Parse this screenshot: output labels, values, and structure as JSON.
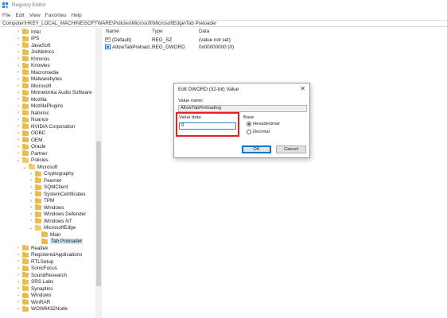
{
  "window": {
    "title": "Registry Editor"
  },
  "menu": [
    "File",
    "Edit",
    "View",
    "Favorites",
    "Help"
  ],
  "address": "Computer\\HKEY_LOCAL_MACHINE\\SOFTWARE\\Policies\\Microsoft\\MicrosoftEdge\\Tab Preloader",
  "tree": [
    {
      "label": "Intel",
      "expanded": false
    },
    {
      "label": "IPS",
      "expanded": false
    },
    {
      "label": "JavaSoft",
      "expanded": false
    },
    {
      "label": "JreMetrics",
      "expanded": false
    },
    {
      "label": "Khronos",
      "expanded": false
    },
    {
      "label": "Knowles",
      "expanded": false
    },
    {
      "label": "Macromedia",
      "expanded": false
    },
    {
      "label": "Malwarebytes",
      "expanded": false
    },
    {
      "label": "Microsoft",
      "expanded": false
    },
    {
      "label": "Minnetonka Audio Software",
      "expanded": false
    },
    {
      "label": "Mozilla",
      "expanded": false
    },
    {
      "label": "MozillaPlugins",
      "expanded": false
    },
    {
      "label": "Nahimic",
      "expanded": false
    },
    {
      "label": "Nuance",
      "expanded": false
    },
    {
      "label": "NVIDIA Corporation",
      "expanded": false
    },
    {
      "label": "ODBC",
      "expanded": false
    },
    {
      "label": "OEM",
      "expanded": false
    },
    {
      "label": "Oracle",
      "expanded": false
    },
    {
      "label": "Partner",
      "expanded": false
    },
    {
      "label": "Policies",
      "expanded": true
    },
    {
      "label": "Microsoft",
      "expanded": true
    },
    {
      "label": "Cryptography",
      "expanded": false
    },
    {
      "label": "Peernet",
      "expanded": false
    },
    {
      "label": "SQMClient",
      "expanded": false
    },
    {
      "label": "SystemCertificates",
      "expanded": false
    },
    {
      "label": "TPM",
      "expanded": false
    },
    {
      "label": "Windows",
      "expanded": false
    },
    {
      "label": "Windows Defender",
      "expanded": false
    },
    {
      "label": "Windows NT",
      "expanded": false
    },
    {
      "label": "MicrosoftEdge",
      "expanded": true
    },
    {
      "label": "Main",
      "expanded": false
    },
    {
      "label": "Tab Preloader",
      "expanded": false,
      "selected": true
    },
    {
      "label": "Realtek",
      "expanded": false
    },
    {
      "label": "RegisteredApplications",
      "expanded": false
    },
    {
      "label": "RTLSetup",
      "expanded": false
    },
    {
      "label": "SonicFocus",
      "expanded": false
    },
    {
      "label": "SoundResearch",
      "expanded": false
    },
    {
      "label": "SRS Labs",
      "expanded": false
    },
    {
      "label": "Synaptics",
      "expanded": false
    },
    {
      "label": "Windows",
      "expanded": false
    },
    {
      "label": "WinRAR",
      "expanded": false
    },
    {
      "label": "WOW6432Node",
      "expanded": false
    }
  ],
  "list": {
    "headers": {
      "name": "Name",
      "type": "Type",
      "data": "Data"
    },
    "rows": [
      {
        "name": "(Default)",
        "type": "REG_SZ",
        "data": "(value not set)",
        "icon": "string-value-icon"
      },
      {
        "name": "AllowTabPreload...",
        "type": "REG_DWORD",
        "data": "0x00000000 (0)",
        "icon": "binary-value-icon"
      }
    ]
  },
  "dialog": {
    "title": "Edit DWORD (32-bit) Value",
    "value_name_label": "Value name:",
    "value_name": "AllowTabPreloading",
    "value_data_label": "Value data:",
    "value_data": "0",
    "base_label": "Base",
    "base_options": [
      "Hexadecimal",
      "Decimal"
    ],
    "base_selected": "Hexadecimal",
    "ok_label": "OK",
    "cancel_label": "Cancel",
    "close_glyph": "✕"
  },
  "colors": {
    "highlight": "#e32222",
    "folder": "#e9bd52",
    "selection": "#cce4f7",
    "accent": "#0078d7"
  }
}
